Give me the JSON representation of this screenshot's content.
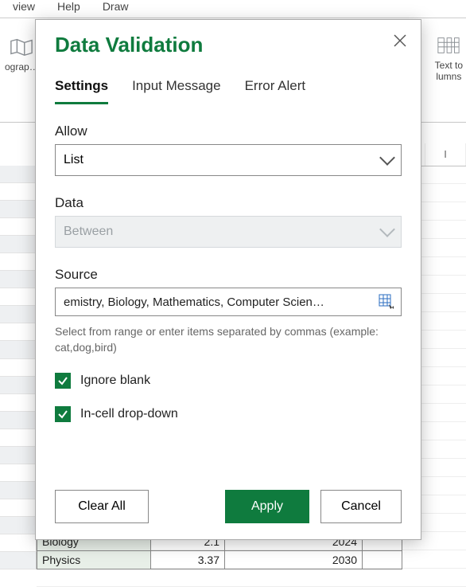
{
  "menubar": {
    "view": "view",
    "help": "Help",
    "draw": "Draw"
  },
  "ribbon": {
    "left_label": "ograp…",
    "right_label1": "Text to",
    "right_label2": "lumns"
  },
  "col_header_i": "I",
  "bottom": {
    "r1c1": "Biology",
    "r1c2": "2.1",
    "r1c3": "2024",
    "r2c1": "Physics",
    "r2c2": "3.37",
    "r2c3": "2030"
  },
  "dialog": {
    "title": "Data Validation",
    "tabs": {
      "settings": "Settings",
      "input": "Input Message",
      "error": "Error Alert"
    },
    "allow_lbl": "Allow",
    "allow_val": "List",
    "data_lbl": "Data",
    "data_val": "Between",
    "source_lbl": "Source",
    "source_val": "emistry, Biology, Mathematics, Computer Scien…",
    "hint": "Select from range or enter items separated by commas (example: cat,dog,bird)",
    "cb1": "Ignore blank",
    "cb2": "In-cell drop-down",
    "clear": "Clear All",
    "apply": "Apply",
    "cancel": "Cancel"
  }
}
